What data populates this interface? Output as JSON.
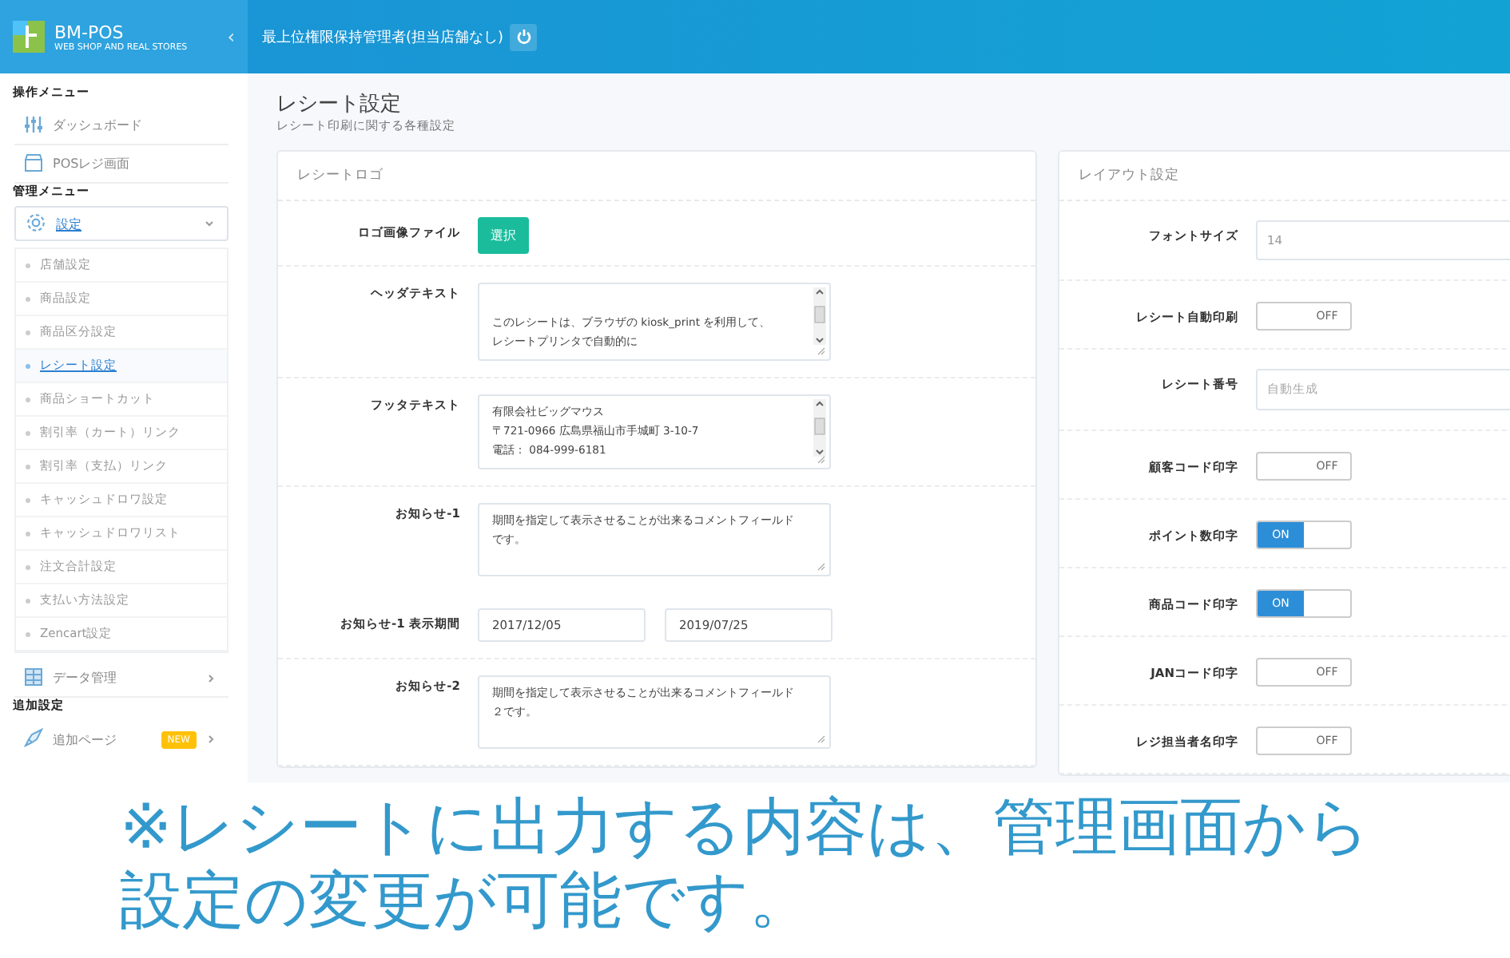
{
  "header": {
    "brand": "BM-POS",
    "tagline": "WEB SHOP AND REAL STORES",
    "collapse": "‹",
    "user": "最上位権限保持管理者(担当店舗なし)"
  },
  "sidebar": {
    "sections": [
      {
        "title": "操作メニュー",
        "items": [
          {
            "label": "ダッシュボード",
            "kind": "link",
            "selected": false
          },
          {
            "label": "POSレジ画面",
            "kind": "link",
            "selected": false
          }
        ]
      },
      {
        "title": "管理メニュー",
        "items": [
          {
            "label": "設定",
            "kind": "group",
            "selected": true,
            "expanded": true,
            "children": [
              {
                "label": "店舗設定",
                "selected": false
              },
              {
                "label": "商品設定",
                "selected": false
              },
              {
                "label": "商品区分設定",
                "selected": false
              },
              {
                "label": "レシート設定",
                "selected": true
              },
              {
                "label": "商品ショートカット",
                "selected": false
              },
              {
                "label": "割引率（カート）リンク",
                "selected": false
              },
              {
                "label": "割引率（支払）リンク",
                "selected": false
              },
              {
                "label": "キャッシュドロワ設定",
                "selected": false
              },
              {
                "label": "キャッシュドロワリスト",
                "selected": false
              },
              {
                "label": "注文合計設定",
                "selected": false
              },
              {
                "label": "支払い方法設定",
                "selected": false
              },
              {
                "label": "Zencart設定",
                "selected": false
              }
            ]
          },
          {
            "label": "データ管理",
            "kind": "group",
            "selected": false,
            "expanded": false
          }
        ]
      },
      {
        "title": "追加設定",
        "items": [
          {
            "label": "追加ページ",
            "kind": "group",
            "selected": false,
            "expanded": false,
            "badge": "NEW"
          }
        ]
      }
    ]
  },
  "page": {
    "title": "レシート設定",
    "subtitle": "レシート印刷に関する各種設定"
  },
  "logo_card": {
    "title": "レシートロゴ",
    "rows": [
      {
        "kind": "button",
        "label": "ロゴ画像ファイル",
        "button": "選択"
      },
      {
        "kind": "textarea",
        "label": "ヘッダテキスト",
        "scrollbar": true,
        "lines": [
          "このレシートは、ブラウザの kiosk_print を利用して、",
          "レシートプリンタで自動的に"
        ]
      },
      {
        "kind": "textarea",
        "label": "フッタテキスト",
        "scrollbar": true,
        "lines": [
          "有限会社ビッグマウス",
          "〒721-0966 広島県福山市手城町 3-10-7",
          "電話： 084-999-6181"
        ]
      },
      {
        "kind": "textarea",
        "label": "お知らせ-1",
        "scrollbar": false,
        "lines": [
          "期間を指定して表示させることが出来るコメントフィールドです。"
        ]
      },
      {
        "kind": "dates",
        "label": "お知らせ-1 表示期間",
        "values": [
          "2017/12/05",
          "2019/07/25"
        ]
      },
      {
        "kind": "textarea",
        "label": "お知らせ-2",
        "scrollbar": false,
        "lines": [
          "期間を指定して表示させることが出来るコメントフィールド２です。"
        ]
      }
    ]
  },
  "layout_card": {
    "title": "レイアウト設定",
    "rows": [
      {
        "kind": "input",
        "label": "フォントサイズ",
        "value": "14"
      },
      {
        "kind": "toggle",
        "label": "レシート自動印刷",
        "on": false,
        "text": "OFF"
      },
      {
        "kind": "input",
        "label": "レシート番号",
        "placeholder": "自動生成"
      },
      {
        "kind": "toggle",
        "label": "顧客コード印字",
        "on": false,
        "text": "OFF"
      },
      {
        "kind": "toggle",
        "label": "ポイント数印字",
        "on": true,
        "text": "ON"
      },
      {
        "kind": "toggle",
        "label": "商品コード印字",
        "on": true,
        "text": "ON"
      },
      {
        "kind": "toggle",
        "label": "JANコード印字",
        "on": false,
        "text": "OFF"
      },
      {
        "kind": "toggle",
        "label": "レジ担当者名印字",
        "on": false,
        "text": "OFF"
      }
    ]
  },
  "caption": "※レシートに出力する内容は、管理画面から設定の変更が可能です。"
}
